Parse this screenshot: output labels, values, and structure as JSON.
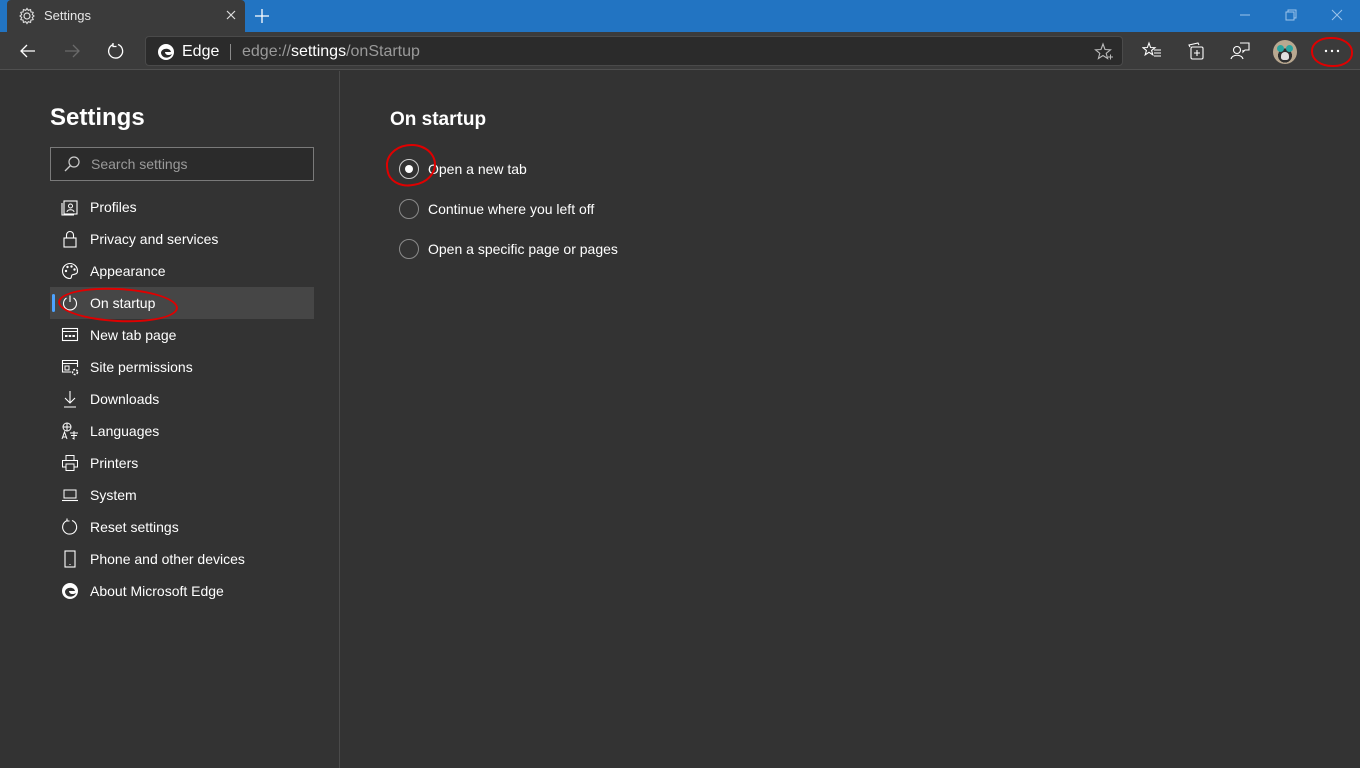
{
  "browser": {
    "tab": {
      "title": "Settings",
      "icon": "gear-icon"
    },
    "new_tab_label": "+",
    "window_controls": [
      "minimize",
      "restore",
      "close"
    ],
    "address_bar": {
      "site_name": "Edge",
      "url_prefix": "edge://",
      "url_host": "settings",
      "url_path": "/onStartup"
    },
    "toolbar_icons": [
      "favorites-icon",
      "collections-icon",
      "feedback-icon",
      "profile-avatar",
      "more-options-icon"
    ]
  },
  "sidebar": {
    "title": "Settings",
    "search": {
      "placeholder": "Search settings",
      "value": ""
    },
    "items": [
      {
        "label": "Profiles",
        "icon": "profiles-icon",
        "active": false
      },
      {
        "label": "Privacy and services",
        "icon": "lock-icon",
        "active": false
      },
      {
        "label": "Appearance",
        "icon": "palette-icon",
        "active": false
      },
      {
        "label": "On startup",
        "icon": "power-icon",
        "active": true
      },
      {
        "label": "New tab page",
        "icon": "new-tab-page-icon",
        "active": false
      },
      {
        "label": "Site permissions",
        "icon": "site-permissions-icon",
        "active": false
      },
      {
        "label": "Downloads",
        "icon": "download-icon",
        "active": false
      },
      {
        "label": "Languages",
        "icon": "languages-icon",
        "active": false
      },
      {
        "label": "Printers",
        "icon": "printer-icon",
        "active": false
      },
      {
        "label": "System",
        "icon": "laptop-icon",
        "active": false
      },
      {
        "label": "Reset settings",
        "icon": "reset-icon",
        "active": false
      },
      {
        "label": "Phone and other devices",
        "icon": "phone-icon",
        "active": false
      },
      {
        "label": "About Microsoft Edge",
        "icon": "edge-logo-icon",
        "active": false
      }
    ]
  },
  "main": {
    "title": "On startup",
    "options": [
      {
        "label": "Open a new tab",
        "selected": true
      },
      {
        "label": "Continue where you left off",
        "selected": false
      },
      {
        "label": "Open a specific page or pages",
        "selected": false
      }
    ]
  },
  "colors": {
    "titlebar": "#2274c2",
    "toolbar": "#3b3b3b",
    "page_background": "#333333",
    "accent": "#4da3ff",
    "annotation": "#e00000"
  }
}
